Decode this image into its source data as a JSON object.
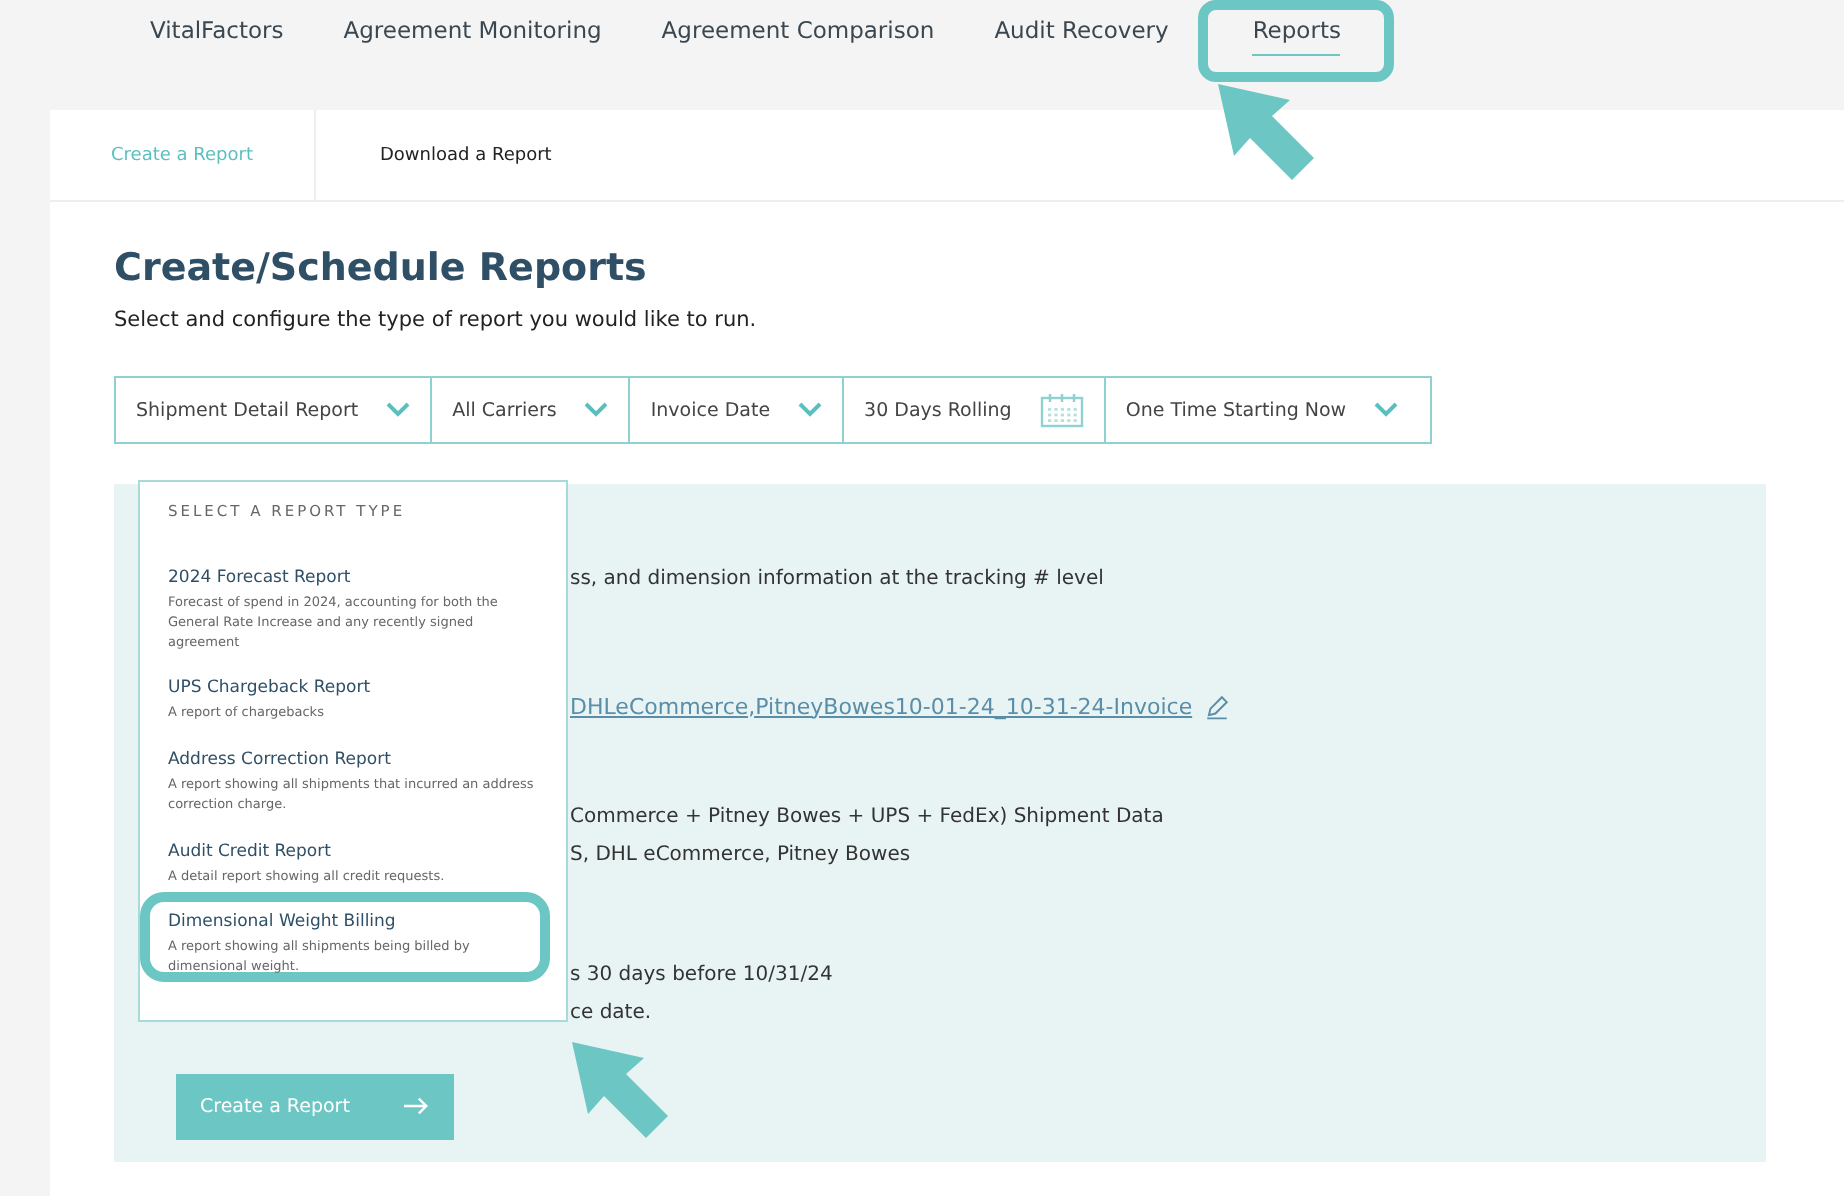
{
  "top_nav": [
    {
      "label": "VitalFactors",
      "selected": false
    },
    {
      "label": "Agreement Monitoring",
      "selected": false
    },
    {
      "label": "Agreement Comparison",
      "selected": false
    },
    {
      "label": "Audit Recovery",
      "selected": false
    },
    {
      "label": "Reports",
      "selected": true
    }
  ],
  "sub_tabs": [
    {
      "label": "Create a Report",
      "selected": true
    },
    {
      "label": "Download a Report",
      "selected": false
    }
  ],
  "title": "Create/Schedule Reports",
  "subtitle": "Select and configure the type of report you would like to run.",
  "filters": [
    {
      "label": "Shipment Detail Report",
      "kind": "dropdown"
    },
    {
      "label": "All Carriers",
      "kind": "dropdown"
    },
    {
      "label": "Invoice Date",
      "kind": "dropdown"
    },
    {
      "label": "30 Days Rolling",
      "kind": "date"
    },
    {
      "label": "One Time Starting Now",
      "kind": "dropdown"
    }
  ],
  "report_menu": {
    "heading": "SELECT A REPORT TYPE",
    "items": [
      {
        "name": "2024 Forecast Report",
        "description": "Forecast of spend in 2024, accounting for both the General Rate Increase and any recently signed agreement"
      },
      {
        "name": "UPS Chargeback Report",
        "description": "A report of chargebacks"
      },
      {
        "name": "Address Correction Report",
        "description": "A report showing all shipments that incurred an address correction charge."
      },
      {
        "name": "Audit Credit Report",
        "description": "A detail report showing all credit requests."
      },
      {
        "name": "Dimensional Weight Billing",
        "description": "A report showing all shipments being billed by dimensional weight."
      }
    ]
  },
  "details": [
    {
      "text": "ss, and dimension information at the tracking # level",
      "kind": "text"
    },
    {
      "text": "DHLeCommerce,PitneyBowes10-01-24_10-31-24-Invoice",
      "kind": "link"
    },
    {
      "text": "Commerce + Pitney Bowes + UPS + FedEx) Shipment Data",
      "kind": "text"
    },
    {
      "text": "S, DHL eCommerce, Pitney Bowes",
      "kind": "text"
    },
    {
      "text": "s 30 days before 10/31/24",
      "kind": "text"
    },
    {
      "text": "ce date.",
      "kind": "text"
    }
  ],
  "create_button": "Create a Report"
}
